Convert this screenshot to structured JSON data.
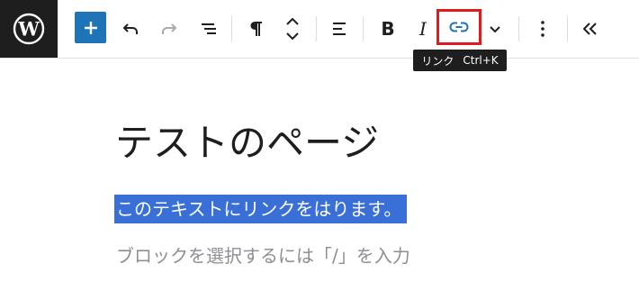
{
  "toolbar": {
    "tooltip": {
      "label": "リンク",
      "shortcut": "Ctrl+K"
    },
    "bold_label": "B",
    "italic_label": "I"
  },
  "editor": {
    "title": "テストのページ",
    "selected_paragraph": "このテキストにリンクをはります。",
    "placeholder": "ブロックを選択するには「/」を入力"
  },
  "colors": {
    "accent": "#1f73b7",
    "selection": "#3a6fd8",
    "highlight_box": "#e01b1b",
    "logo_bg": "#1e1e1e",
    "tooltip_bg": "#1e1e1e"
  },
  "icons": [
    "wordpress-logo-icon",
    "plus-icon",
    "undo-icon",
    "redo-icon",
    "list-view-icon",
    "paragraph-icon",
    "move-up-down-icon",
    "align-left-icon",
    "link-icon",
    "chevron-down-icon",
    "more-options-icon",
    "collapse-icon"
  ]
}
